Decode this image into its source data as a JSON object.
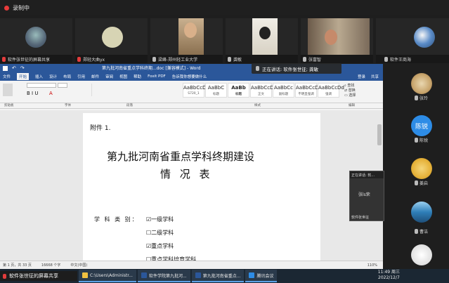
{
  "meeting": {
    "recording_label": "录制中",
    "talking_label": "正在讲话: 软件张世征; 龚敏",
    "share_label": "软件张世征的屏幕共享"
  },
  "gallery": [
    {
      "name": "软件张世征的屏幕共享"
    },
    {
      "name": "郑轻大曲yx"
    },
    {
      "name": "梁峰-郑州轻工业大学"
    },
    {
      "name": "龚敏"
    },
    {
      "name": "张富智"
    },
    {
      "name": "软件王商海"
    }
  ],
  "side_list": [
    {
      "name": "张玲"
    },
    {
      "name": "陈锐",
      "avatar_text": "陈锐"
    },
    {
      "name": "陈锐"
    },
    {
      "name": "姜启"
    },
    {
      "name": "曹洁"
    },
    {
      "name": "王猛"
    }
  ],
  "self_view": {
    "header": "正在讲话: 软...",
    "name": "张ls荣",
    "footer": "软件张世征"
  },
  "word": {
    "title": "第九批河南省重点学科终期...doc [兼容模式] - Word",
    "menus": [
      "文件",
      "开始",
      "插入",
      "设计",
      "布局",
      "引用",
      "邮件",
      "审阅",
      "视图",
      "帮助",
      "Foxit PDF",
      "告诉我你想要做什么"
    ],
    "right_menu": [
      "登录",
      "共享"
    ],
    "styles": [
      {
        "sample": "AaBbCcDd",
        "name": "S720_1"
      },
      {
        "sample": "AaBbC",
        "name": "标题"
      },
      {
        "sample": "AaBb",
        "name": "标题"
      },
      {
        "sample": "AaBbCcDd",
        "name": "正文"
      },
      {
        "sample": "AaBbCc",
        "name": "副标题"
      },
      {
        "sample": "AaBbCcDd",
        "name": "不明显强调"
      },
      {
        "sample": "AaBbCcDd",
        "name": "强调"
      }
    ],
    "groups": [
      "剪贴板",
      "字体",
      "段落",
      "样式",
      "编辑"
    ],
    "status": [
      "第 1 页，共 33 页",
      "16668 个字",
      "中文(中国)"
    ],
    "zoom": "110%"
  },
  "document": {
    "annex": "附件 1.",
    "heading1": "第九批河南省重点学科终期建设",
    "heading2": "情  况  表",
    "field_label": "学 科 类 别：",
    "options": [
      "一级学科",
      "二级学科",
      "重点学科",
      "重点学科培育学科"
    ],
    "checked": [
      true,
      false,
      true,
      false
    ]
  },
  "taskbar": {
    "items": [
      "软件张世征的屏幕共享",
      "C:\\Users\\Administr...",
      "软件学院第九批河...",
      "第九批河南省重点...",
      "腾讯会议"
    ],
    "time": "11:49 周三",
    "date": "2022/12/7"
  },
  "colors": {
    "word_blue": "#2b579a",
    "taskbar": "#1b2733",
    "accent": "#5aa0e6"
  }
}
